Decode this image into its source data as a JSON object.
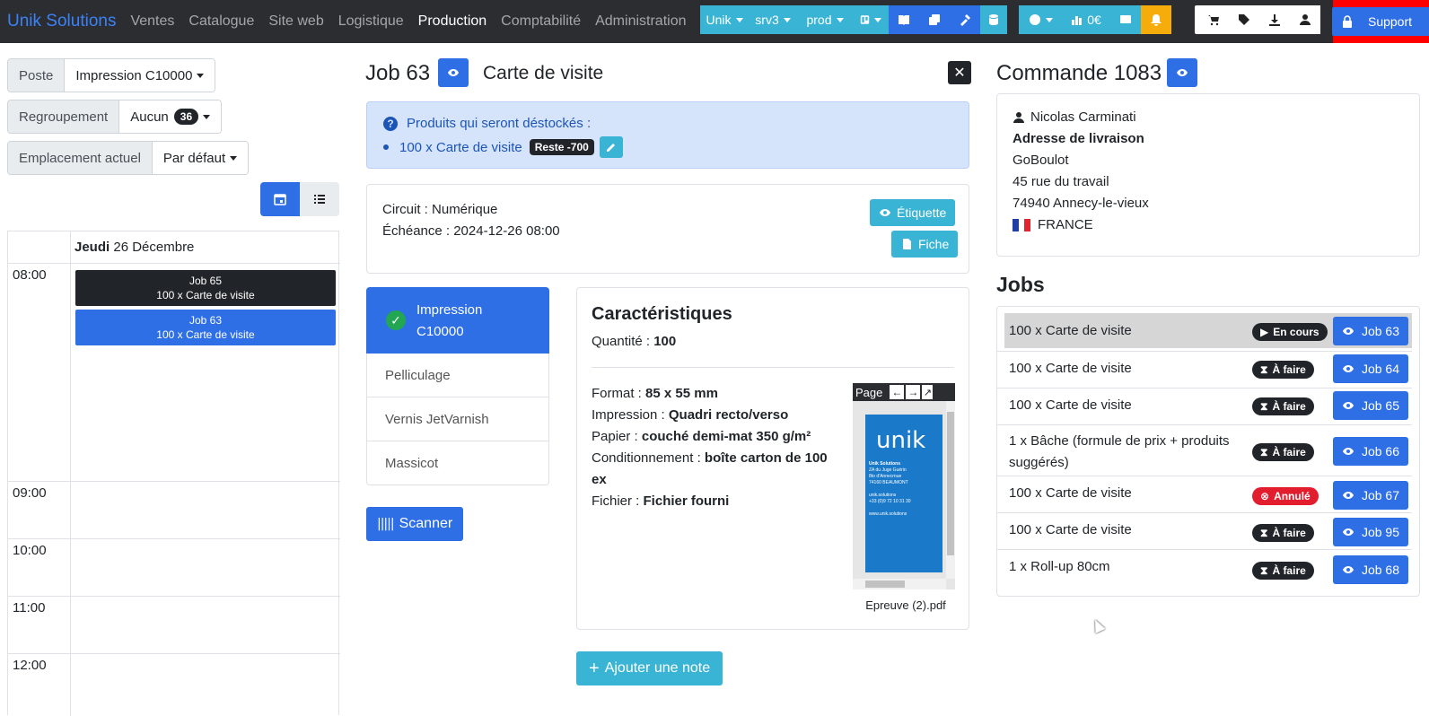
{
  "brand": "Unik Solutions",
  "nav": [
    "Ventes",
    "Catalogue",
    "Site web",
    "Logistique",
    "Production",
    "Comptabilité",
    "Administration"
  ],
  "nav_active": "Production",
  "toolbar": {
    "unik": "Unik",
    "srv": "srv3",
    "env": "prod",
    "revenue": "0€",
    "support": "Support"
  },
  "left": {
    "poste_label": "Poste",
    "poste_value": "Impression C10000",
    "group_label": "Regroupement",
    "group_value": "Aucun",
    "group_count": "36",
    "loc_label": "Emplacement actuel",
    "loc_value": "Par défaut",
    "day_bold": "Jeudi",
    "day_rest": "26 Décembre",
    "times": [
      "08:00",
      "09:00",
      "10:00",
      "11:00",
      "12:00"
    ],
    "events": [
      {
        "title": "Job 65",
        "sub": "100 x Carte de visite",
        "color": "#212529"
      },
      {
        "title": "Job 63",
        "sub": "100 x Carte de visite",
        "color": "#2f6fe6"
      }
    ]
  },
  "job": {
    "title": "Job 63",
    "product": "Carte de visite",
    "alert_title": "Produits qui seront déstockés :",
    "alert_item": "100 x Carte de visite",
    "alert_tag": "Reste -700",
    "circuit_label": "Circuit : ",
    "circuit": "Numérique",
    "due_label": "Échéance : ",
    "due": "2024-12-26 08:00",
    "btn_label": "Étiquette",
    "btn_sheet": "Fiche",
    "steps": [
      {
        "label": "Impression C10000",
        "active": true
      },
      {
        "label": "Pelliculage",
        "active": false
      },
      {
        "label": "Vernis JetVarnish",
        "active": false
      },
      {
        "label": "Massicot",
        "active": false
      }
    ],
    "scan": "Scanner",
    "char_title": "Caractéristiques",
    "qty_label": "Quantité : ",
    "qty": "100",
    "format_label": "Format : ",
    "format": "85 x 55 mm",
    "print_label": "Impression : ",
    "print": "Quadri recto/verso",
    "paper_label": "Papier : ",
    "paper": "couché demi-mat 350 g/m²",
    "pack_label": "Conditionnement : ",
    "pack": "boîte carton de 100 ex",
    "file_label": "Fichier : ",
    "file": "Fichier fourni",
    "preview_page": "Page",
    "preview_logo": "unik",
    "preview_lines": [
      "Unik Solutions",
      "ZA du Juge Guérin",
      "8to d'Annecrnue",
      "74160 BEAUMONT",
      "",
      "unik.solutions",
      "+33 (0)9 72 10 31 30",
      "",
      "www.unik.solutions"
    ],
    "preview_file": "Epreuve (2).pdf",
    "add_note": "Ajouter une note"
  },
  "order": {
    "title": "Commande 1083",
    "client": "Nicolas Carminati",
    "addr_label": "Adresse de livraison",
    "addr": [
      "GoBoulot",
      "45 rue du travail",
      "74940 Annecy-le-vieux"
    ],
    "country": "FRANCE"
  },
  "jobs_title": "Jobs",
  "jobs": [
    {
      "name": "100 x Carte de visite",
      "status": "En cours",
      "status_color": "#212529",
      "btn": "Job 63",
      "highlight": true
    },
    {
      "name": "100 x Carte de visite",
      "status": "À faire",
      "status_color": "#212529",
      "btn": "Job 64"
    },
    {
      "name": "100 x Carte de visite",
      "status": "À faire",
      "status_color": "#212529",
      "btn": "Job 65"
    },
    {
      "name": "1 x Bâche (formule de prix + produits suggérés)",
      "status": "À faire",
      "status_color": "#212529",
      "btn": "Job 66"
    },
    {
      "name": "100 x Carte de visite",
      "status": "Annulé",
      "status_color": "#e11d2e",
      "btn": "Job 67"
    },
    {
      "name": "100 x Carte de visite",
      "status": "À faire",
      "status_color": "#212529",
      "btn": "Job 95"
    },
    {
      "name": "1 x Roll-up 80cm",
      "status": "À faire",
      "status_color": "#212529",
      "btn": "Job 68"
    }
  ]
}
